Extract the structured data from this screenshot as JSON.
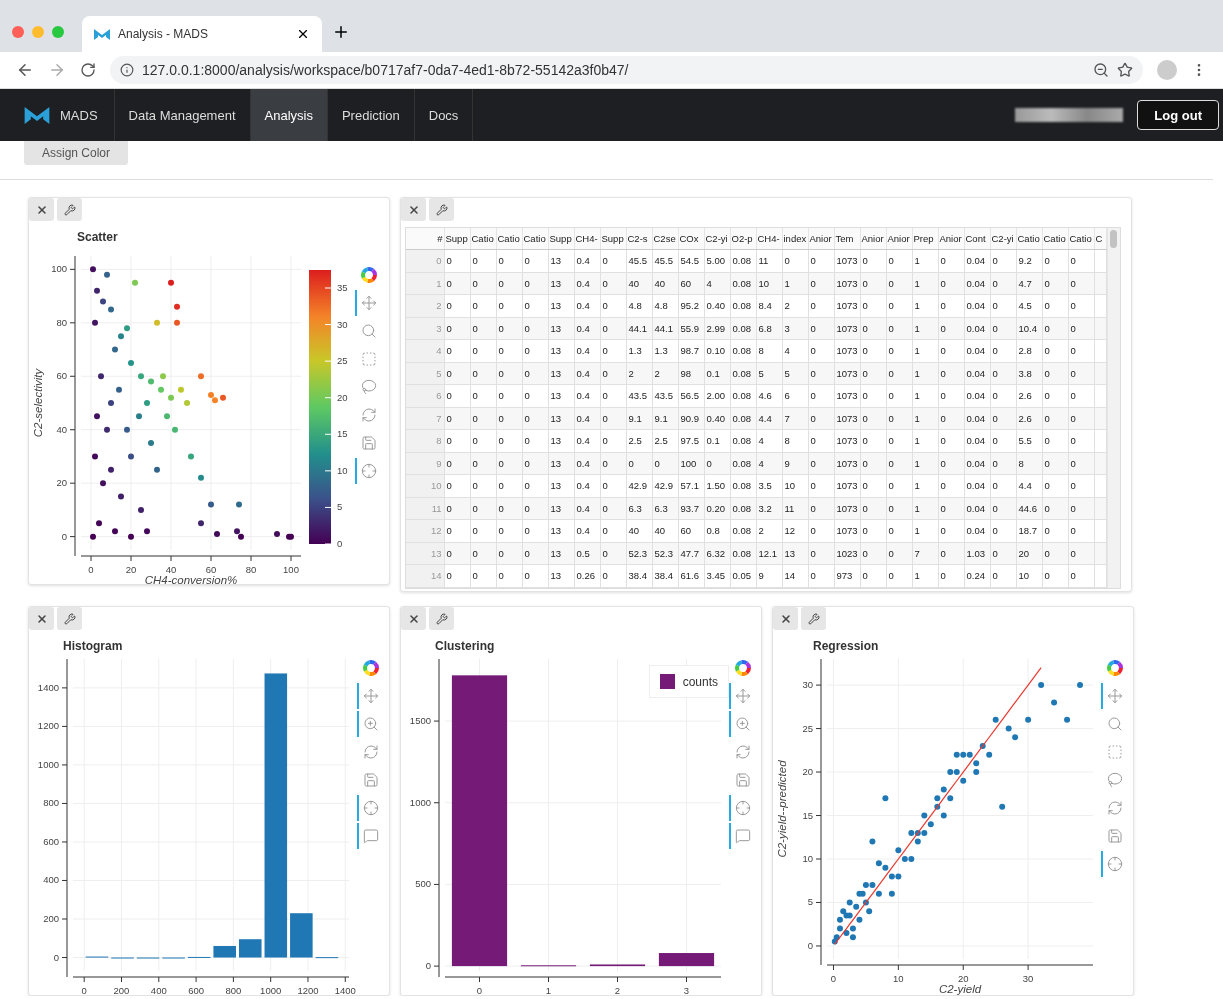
{
  "browser": {
    "tab_title": "Analysis - MADS",
    "url": "127.0.0.1:8000/analysis/workspace/b0717af7-0da7-4ed1-8b72-55142a3f0b47/"
  },
  "navbar": {
    "brand": "MADS",
    "items": [
      {
        "label": "Data Management",
        "selected": false
      },
      {
        "label": "Analysis",
        "selected": true
      },
      {
        "label": "Prediction",
        "selected": false
      },
      {
        "label": "Docs",
        "selected": false
      }
    ],
    "logout": "Log out"
  },
  "toolbar": {
    "assign_color": "Assign Color"
  },
  "scatter": {
    "title": "Scatter",
    "tools": [
      {
        "kind": "move",
        "active": true
      },
      {
        "kind": "box-zoom",
        "active": false
      },
      {
        "kind": "box-select",
        "active": false
      },
      {
        "kind": "lasso",
        "active": false
      },
      {
        "kind": "reset",
        "active": false
      },
      {
        "kind": "save",
        "active": false
      },
      {
        "kind": "crosshair",
        "active": true
      }
    ],
    "colorbar": {
      "ticks": [
        "35",
        "30",
        "25",
        "20",
        "15",
        "10",
        "5",
        "0"
      ]
    },
    "chart_data": {
      "type": "scatter",
      "grid": true,
      "xlabel": "CH4-conversion%",
      "ylabel": "C2-selectivity",
      "xlim": [
        -5,
        105
      ],
      "ylim": [
        -5,
        105
      ],
      "xticks": [
        0,
        20,
        40,
        60,
        80,
        100
      ],
      "yticks": [
        0,
        20,
        40,
        60,
        80,
        100
      ],
      "x": [
        1,
        8,
        3,
        6,
        10,
        15,
        12,
        18,
        22,
        20,
        25,
        30,
        35,
        28,
        40,
        45,
        38,
        42,
        48,
        55,
        60,
        66,
        62,
        40,
        43,
        43,
        5,
        3,
        8,
        2,
        6,
        10,
        15,
        4,
        12,
        20,
        28,
        25,
        30,
        33,
        18,
        20,
        50,
        55,
        55,
        60,
        74,
        63,
        73,
        75,
        93,
        99,
        100,
        1,
        2,
        14,
        24,
        36,
        33,
        10
      ],
      "series": [
        {
          "values": [
            100,
            98,
            92,
            88,
            85,
            75,
            70,
            78,
            95,
            65,
            60,
            58,
            55,
            50,
            52,
            55,
            45,
            40,
            50,
            60,
            53,
            52,
            51,
            95,
            86,
            80,
            60,
            45,
            40,
            30,
            20,
            25,
            15,
            5,
            2,
            0,
            2,
            10,
            35,
            25,
            40,
            30,
            30,
            22,
            5,
            12,
            12,
            1,
            2,
            0,
            1,
            0,
            0,
            0,
            80,
            55,
            45,
            60,
            80,
            50
          ]
        }
      ]
    }
  },
  "table": {
    "columns": [
      "#",
      "Supp",
      "Catio",
      "Catio",
      "Catio",
      "Supp",
      "CH4-",
      "Supp",
      "C2-s",
      "C2se",
      "COx",
      "C2-yi",
      "O2-p",
      "CH4-",
      "index",
      "Anior",
      "Tem",
      "Anior",
      "Anior",
      "Prep",
      "Anior",
      "Cont",
      "C2-yi",
      "Catio",
      "Catio",
      "Catio",
      "C"
    ],
    "rows": [
      {
        "cells": [
          "0",
          "0",
          "0",
          "0",
          "0",
          "13",
          "0.4",
          "0",
          "45.5",
          "45.5",
          "54.5",
          "5.00",
          "0.08",
          "11",
          "0",
          "0",
          "1073",
          "0",
          "0",
          "1",
          "0",
          "0.04",
          "0",
          "9.2",
          "0",
          "0"
        ]
      },
      {
        "cells": [
          "1",
          "0",
          "0",
          "0",
          "0",
          "13",
          "0.4",
          "0",
          "40",
          "40",
          "60",
          "4",
          "0.08",
          "10",
          "1",
          "0",
          "1073",
          "0",
          "0",
          "1",
          "0",
          "0.04",
          "0",
          "4.7",
          "0",
          "0"
        ]
      },
      {
        "cells": [
          "2",
          "0",
          "0",
          "0",
          "0",
          "13",
          "0.4",
          "0",
          "4.8",
          "4.8",
          "95.2",
          "0.40",
          "0.08",
          "8.4",
          "2",
          "0",
          "1073",
          "0",
          "0",
          "1",
          "0",
          "0.04",
          "0",
          "4.5",
          "0",
          "0"
        ]
      },
      {
        "cells": [
          "3",
          "0",
          "0",
          "0",
          "0",
          "13",
          "0.4",
          "0",
          "44.1",
          "44.1",
          "55.9",
          "2.99",
          "0.08",
          "6.8",
          "3",
          "0",
          "1073",
          "0",
          "0",
          "1",
          "0",
          "0.04",
          "0",
          "10.4",
          "0",
          "0"
        ]
      },
      {
        "cells": [
          "4",
          "0",
          "0",
          "0",
          "0",
          "13",
          "0.4",
          "0",
          "1.3",
          "1.3",
          "98.7",
          "0.10",
          "0.08",
          "8",
          "4",
          "0",
          "1073",
          "0",
          "0",
          "1",
          "0",
          "0.04",
          "0",
          "2.8",
          "0",
          "0"
        ]
      },
      {
        "cells": [
          "5",
          "0",
          "0",
          "0",
          "0",
          "13",
          "0.4",
          "0",
          "2",
          "2",
          "98",
          "0.1",
          "0.08",
          "5",
          "5",
          "0",
          "1073",
          "0",
          "0",
          "1",
          "0",
          "0.04",
          "0",
          "3.8",
          "0",
          "0"
        ]
      },
      {
        "cells": [
          "6",
          "0",
          "0",
          "0",
          "0",
          "13",
          "0.4",
          "0",
          "43.5",
          "43.5",
          "56.5",
          "2.00",
          "0.08",
          "4.6",
          "6",
          "0",
          "1073",
          "0",
          "0",
          "1",
          "0",
          "0.04",
          "0",
          "2.6",
          "0",
          "0"
        ]
      },
      {
        "cells": [
          "7",
          "0",
          "0",
          "0",
          "0",
          "13",
          "0.4",
          "0",
          "9.1",
          "9.1",
          "90.9",
          "0.40",
          "0.08",
          "4.4",
          "7",
          "0",
          "1073",
          "0",
          "0",
          "1",
          "0",
          "0.04",
          "0",
          "2.6",
          "0",
          "0"
        ]
      },
      {
        "cells": [
          "8",
          "0",
          "0",
          "0",
          "0",
          "13",
          "0.4",
          "0",
          "2.5",
          "2.5",
          "97.5",
          "0.1",
          "0.08",
          "4",
          "8",
          "0",
          "1073",
          "0",
          "0",
          "1",
          "0",
          "0.04",
          "0",
          "5.5",
          "0",
          "0"
        ]
      },
      {
        "cells": [
          "9",
          "0",
          "0",
          "0",
          "0",
          "13",
          "0.4",
          "0",
          "0",
          "0",
          "100",
          "0",
          "0.08",
          "4",
          "9",
          "0",
          "1073",
          "0",
          "0",
          "1",
          "0",
          "0.04",
          "0",
          "8",
          "0",
          "0"
        ]
      },
      {
        "cells": [
          "10",
          "0",
          "0",
          "0",
          "0",
          "13",
          "0.4",
          "0",
          "42.9",
          "42.9",
          "57.1",
          "1.50",
          "0.08",
          "3.5",
          "10",
          "0",
          "1073",
          "0",
          "0",
          "1",
          "0",
          "0.04",
          "0",
          "4.4",
          "0",
          "0"
        ]
      },
      {
        "cells": [
          "11",
          "0",
          "0",
          "0",
          "0",
          "13",
          "0.4",
          "0",
          "6.3",
          "6.3",
          "93.7",
          "0.20",
          "0.08",
          "3.2",
          "11",
          "0",
          "1073",
          "0",
          "0",
          "1",
          "0",
          "0.04",
          "0",
          "44.6",
          "0",
          "0"
        ]
      },
      {
        "cells": [
          "12",
          "0",
          "0",
          "0",
          "0",
          "13",
          "0.4",
          "0",
          "40",
          "40",
          "60",
          "0.8",
          "0.08",
          "2",
          "12",
          "0",
          "1073",
          "0",
          "0",
          "1",
          "0",
          "0.04",
          "0",
          "18.7",
          "0",
          "0"
        ]
      },
      {
        "cells": [
          "13",
          "0",
          "0",
          "0",
          "0",
          "13",
          "0.5",
          "0",
          "52.3",
          "52.3",
          "47.7",
          "6.32",
          "0.08",
          "12.1",
          "13",
          "0",
          "1023",
          "0",
          "0",
          "7",
          "0",
          "1.03",
          "0",
          "20",
          "0",
          "0"
        ]
      },
      {
        "cells": [
          "14",
          "0",
          "0",
          "0",
          "0",
          "13",
          "0.26",
          "0",
          "38.4",
          "38.4",
          "61.6",
          "3.45",
          "0.05",
          "9",
          "14",
          "0",
          "973",
          "0",
          "0",
          "1",
          "0",
          "0.24",
          "0",
          "10",
          "0",
          "0"
        ]
      }
    ]
  },
  "histogram": {
    "title": "Histogram",
    "tools": [
      {
        "kind": "move",
        "active": true
      },
      {
        "kind": "wheel-zoom",
        "active": true
      },
      {
        "kind": "reset",
        "active": false
      },
      {
        "kind": "save",
        "active": false
      },
      {
        "kind": "crosshair",
        "active": true
      },
      {
        "kind": "hover",
        "active": true
      }
    ],
    "chart_data": {
      "type": "bar",
      "grid": true,
      "xlim": [
        -60,
        1420
      ],
      "ylim": [
        -70,
        1550
      ],
      "xticks": [
        0,
        200,
        400,
        600,
        800,
        1000,
        1200,
        1400
      ],
      "yticks": [
        0,
        200,
        400,
        600,
        800,
        1000,
        1200,
        1400
      ],
      "x": [
        68.5,
        205.5,
        342.5,
        479.5,
        616.5,
        753.5,
        890.5,
        1027.5,
        1164.5,
        1301.5
      ],
      "series": [
        {
          "color": "#1f77b4",
          "values": [
            5,
            0,
            0,
            0,
            3,
            60,
            95,
            1475,
            230,
            2
          ]
        }
      ]
    }
  },
  "clustering": {
    "title": "Clustering",
    "tools": [
      {
        "kind": "move",
        "active": true
      },
      {
        "kind": "wheel-zoom",
        "active": true
      },
      {
        "kind": "reset",
        "active": false
      },
      {
        "kind": "save",
        "active": false
      },
      {
        "kind": "crosshair",
        "active": true
      },
      {
        "kind": "hover",
        "active": true
      }
    ],
    "chart_data": {
      "type": "bar",
      "grid": true,
      "ylim": [
        -30,
        1880
      ],
      "yticks": [
        0,
        500,
        1000,
        1500
      ],
      "categories": [
        "0",
        "1",
        "2",
        "3"
      ],
      "series": [
        {
          "name": "counts",
          "color": "#761a78",
          "values": [
            1780,
            5,
            10,
            80
          ]
        }
      ]
    }
  },
  "regression": {
    "title": "Regression",
    "tools": [
      {
        "kind": "move",
        "active": true
      },
      {
        "kind": "box-zoom",
        "active": false
      },
      {
        "kind": "box-select",
        "active": false
      },
      {
        "kind": "lasso",
        "active": false
      },
      {
        "kind": "reset",
        "active": false
      },
      {
        "kind": "save",
        "active": false
      },
      {
        "kind": "crosshair",
        "active": true
      }
    ],
    "chart_data": {
      "type": "scatter",
      "grid": true,
      "xlabel": "C2-yield",
      "ylabel": "C2-yield--predicted",
      "xlim": [
        -1,
        40
      ],
      "ylim": [
        -1.5,
        33
      ],
      "xticks": [
        0,
        10,
        20,
        30
      ],
      "yticks": [
        0,
        5,
        10,
        15,
        20,
        25,
        30
      ],
      "x": [
        0.2,
        0.5,
        1,
        1.5,
        2,
        2.5,
        3,
        3.5,
        4,
        4.5,
        5,
        5.5,
        6,
        7,
        8,
        9,
        10,
        11,
        12,
        13,
        14,
        15,
        16,
        17,
        18,
        19,
        20,
        21,
        22,
        23,
        24,
        25,
        26,
        27,
        28,
        30,
        32,
        34,
        36,
        38,
        1,
        2,
        3,
        5,
        7,
        9,
        12,
        14,
        16,
        18,
        20,
        8,
        10,
        6,
        4,
        2.5,
        13,
        17,
        19,
        22
      ],
      "series": [
        {
          "type": "scatter",
          "color": "#1f77b4",
          "values": [
            0.5,
            1,
            2,
            4,
            1.5,
            5,
            2,
            4.5,
            3,
            6,
            5,
            4,
            7,
            6,
            9,
            8,
            11,
            10,
            13,
            12,
            15,
            14,
            16,
            18,
            17,
            20,
            19,
            22,
            21,
            23,
            22,
            26,
            16,
            25,
            24,
            26,
            30,
            28,
            26,
            30,
            3,
            3.5,
            1,
            7,
            9.5,
            6,
            10,
            13,
            17,
            20,
            22,
            17,
            8,
            12,
            6,
            3.5,
            13,
            15,
            22,
            20
          ]
        },
        {
          "type": "line",
          "color": "#e8392f",
          "values": [
            0.2,
            0.5,
            1,
            1.5,
            2,
            2.5,
            3,
            3.5,
            4,
            4.5,
            5,
            5.5,
            6,
            7,
            8,
            9,
            10,
            11,
            12,
            13,
            14,
            15,
            16,
            17,
            18,
            19,
            20,
            21,
            22,
            23,
            24,
            25,
            26,
            27,
            28,
            30,
            32,
            null,
            null,
            null,
            1,
            2,
            3,
            5,
            7,
            9,
            12,
            14,
            16,
            18,
            20,
            8,
            10,
            6,
            4,
            2.5,
            13,
            17,
            19,
            22
          ]
        }
      ]
    }
  }
}
